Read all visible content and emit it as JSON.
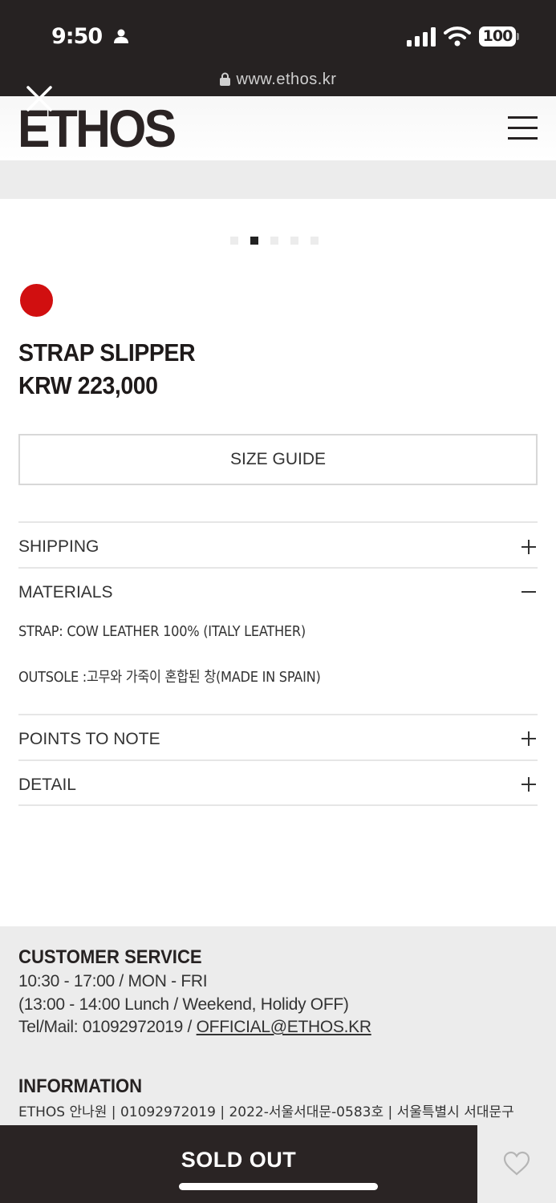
{
  "status_bar": {
    "time": "9:50",
    "battery": "100"
  },
  "browser": {
    "url": "www.ethos.kr"
  },
  "header": {
    "logo": "ETHOS"
  },
  "carousel": {
    "total": 5,
    "active_index": 1
  },
  "product": {
    "color_swatch": "#d10f10",
    "name": "STRAP SLIPPER",
    "price": "KRW 223,000",
    "size_guide_label": "SIZE GUIDE"
  },
  "accordion": {
    "shipping": "SHIPPING",
    "materials": "MATERIALS",
    "materials_lines": [
      "STRAP: COW LEATHER 100% (ITALY LEATHER)",
      "OUTSOLE :고무와 가죽이 혼합된 창(MADE IN SPAIN)"
    ],
    "points_to_note": "POINTS TO NOTE",
    "detail": "DETAIL"
  },
  "footer": {
    "customer_service_title": "CUSTOMER SERVICE",
    "hours": "10:30 - 17:00 / MON - FRI",
    "lunch": "(13:00 - 14:00 Lunch / Weekend, Holidy OFF)",
    "contact_prefix": "Tel/Mail: 01092972019 / ",
    "email": "OFFICIAL@ETHOS.KR",
    "information_title": "INFORMATION",
    "information_text": "ETHOS 안나원 | 01092972019 | 2022-서울서대문-0583호 | 서울특별시 서대문구"
  },
  "actions": {
    "sold_out": "SOLD OUT"
  },
  "colors": {
    "dark": "#262222",
    "accent_red": "#d10f10",
    "footer_bg": "#ececec"
  }
}
